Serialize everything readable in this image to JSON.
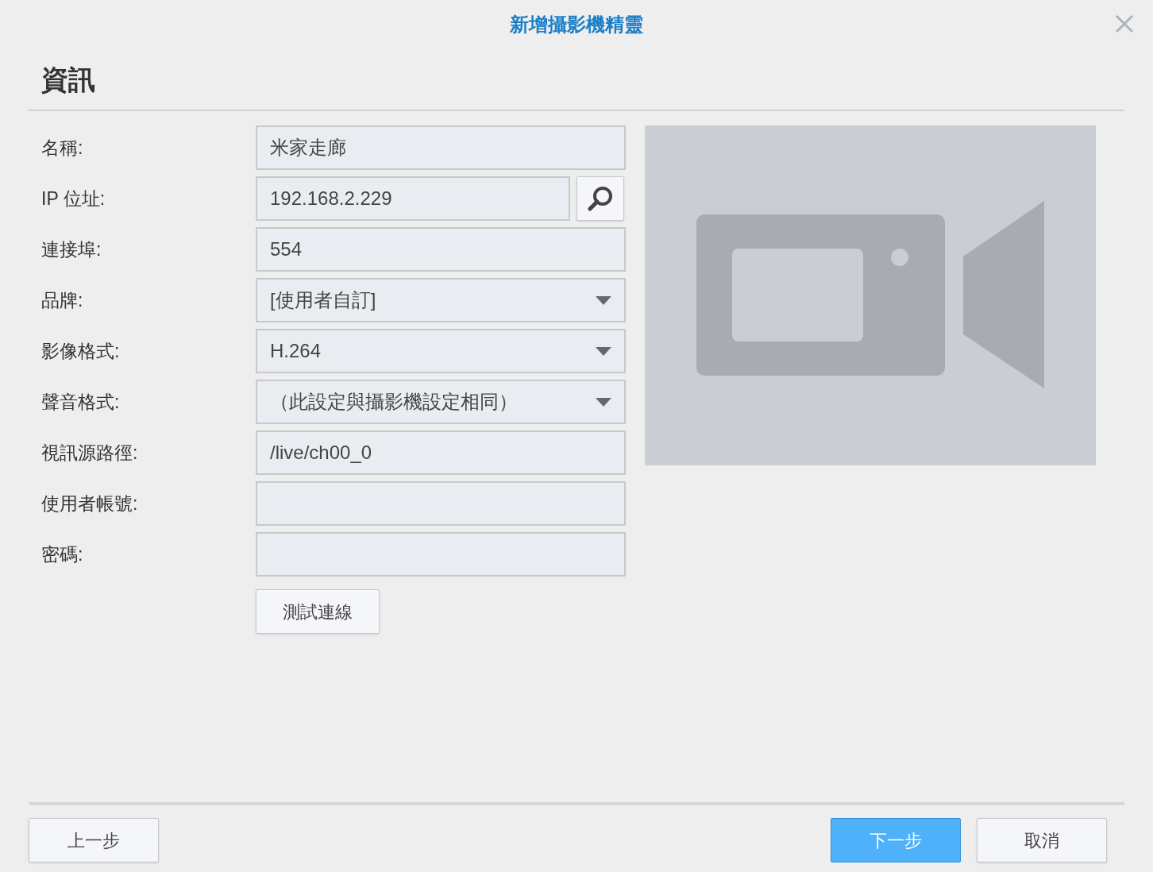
{
  "window": {
    "title": "新增攝影機精靈"
  },
  "section": {
    "title": "資訊"
  },
  "fields": [
    {
      "label": "名稱:",
      "kind": "text",
      "value": "米家走廊"
    },
    {
      "label": "IP 位址:",
      "kind": "search",
      "value": "192.168.2.229"
    },
    {
      "label": "連接埠:",
      "kind": "text",
      "value": "554"
    },
    {
      "label": "品牌:",
      "kind": "select",
      "value": "[使用者自訂]"
    },
    {
      "label": "影像格式:",
      "kind": "select",
      "value": "H.264"
    },
    {
      "label": "聲音格式:",
      "kind": "select",
      "value": "（此設定與攝影機設定相同）"
    },
    {
      "label": "視訊源路徑:",
      "kind": "text",
      "value": "/live/ch00_0"
    },
    {
      "label": "使用者帳號:",
      "kind": "text"
    },
    {
      "label": "密碼:",
      "kind": "text"
    }
  ],
  "test_button": "測試連線",
  "footer": {
    "left": [
      {
        "label": "上一步",
        "kind": "default"
      }
    ],
    "right": [
      {
        "label": "下一步",
        "kind": "primary"
      },
      {
        "label": "取消",
        "kind": "default"
      }
    ]
  }
}
